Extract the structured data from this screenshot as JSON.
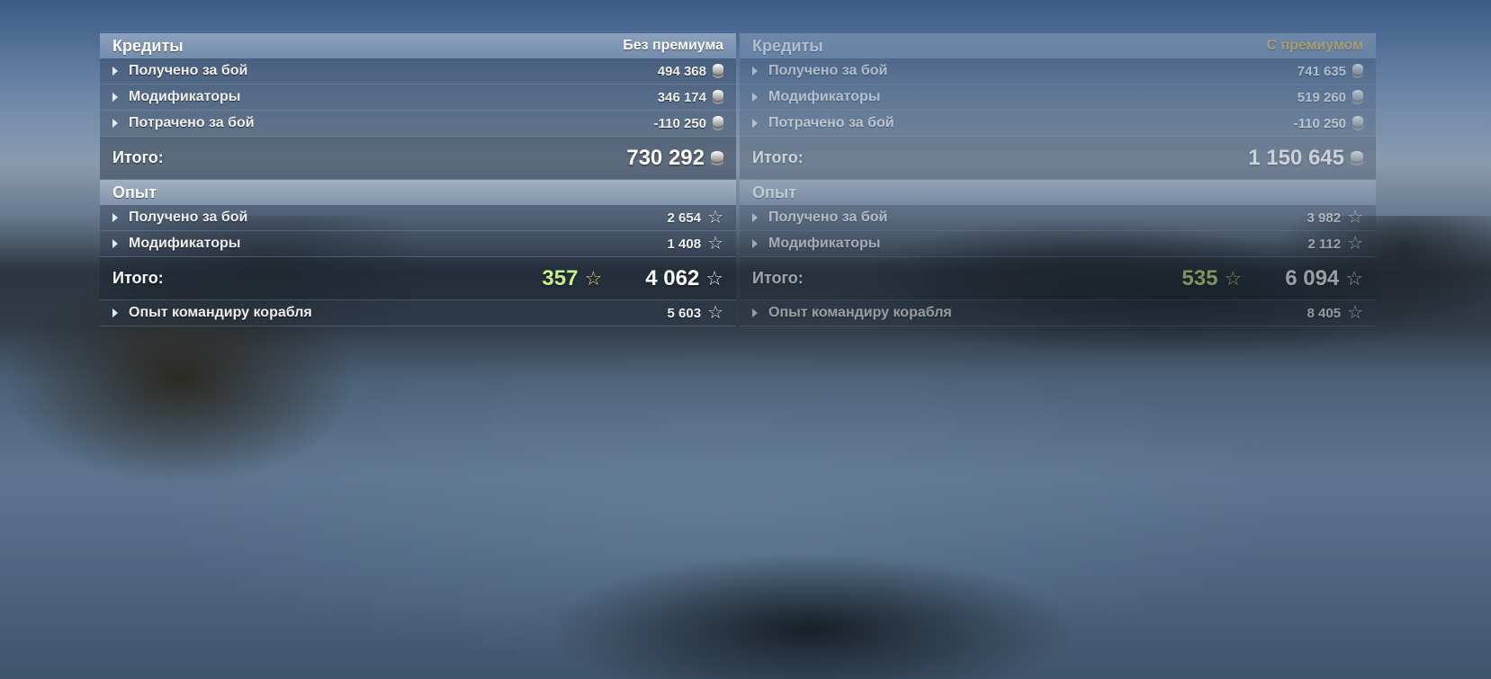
{
  "left": {
    "credits": {
      "title": "Кредиты",
      "tag": "Без премиума",
      "rows": [
        {
          "label": "Получено за бой",
          "value": "494 368"
        },
        {
          "label": "Модификаторы",
          "value": "346 174"
        },
        {
          "label": "Потрачено за бой",
          "value": "-110 250"
        }
      ],
      "total_label": "Итого:",
      "total_value": "730 292"
    },
    "xp": {
      "title": "Опыт",
      "rows": [
        {
          "label": "Получено за бой",
          "value": "2 654"
        },
        {
          "label": "Модификаторы",
          "value": "1 408"
        }
      ],
      "total_label": "Итого:",
      "bonus_value": "357",
      "total_value": "4 062",
      "commander_label": "Опыт командиру корабля",
      "commander_value": "5 603"
    }
  },
  "right": {
    "credits": {
      "title": "Кредиты",
      "tag": "С премиумом",
      "rows": [
        {
          "label": "Получено за бой",
          "value": "741 635"
        },
        {
          "label": "Модификаторы",
          "value": "519 260"
        },
        {
          "label": "Потрачено за бой",
          "value": "-110 250"
        }
      ],
      "total_label": "Итого:",
      "total_value": "1 150 645"
    },
    "xp": {
      "title": "Опыт",
      "rows": [
        {
          "label": "Получено за бой",
          "value": "3 982"
        },
        {
          "label": "Модификаторы",
          "value": "2 112"
        }
      ],
      "total_label": "Итого:",
      "bonus_value": "535",
      "total_value": "6 094",
      "commander_label": "Опыт командиру корабля",
      "commander_value": "8 405"
    }
  },
  "icons": {
    "credits": "coin-stack-icon",
    "xp": "star-icon",
    "expand": "triangle-right-icon"
  },
  "colors": {
    "premium_tag": "#f1c25a",
    "bonus_xp": "#c5f08a"
  }
}
